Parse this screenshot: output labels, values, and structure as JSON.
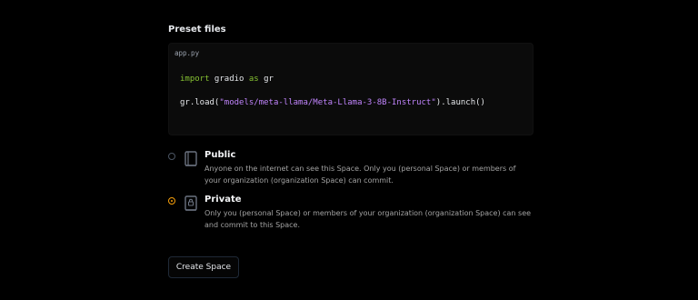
{
  "preset_files": {
    "title": "Preset files",
    "filename": "app.py",
    "code": {
      "line1": {
        "kw1": "import",
        "mod": " gradio ",
        "kw2": "as",
        "alias": " gr"
      },
      "line2": {
        "obj": "gr",
        "call_open": ".load(",
        "string": "\"models/meta-llama/Meta-Llama-3-8B-Instruct\"",
        "call_close": ").launch()"
      }
    }
  },
  "visibility": {
    "options": [
      {
        "title": "Public",
        "description": "Anyone on the internet can see this Space. Only you (personal Space) or members of your organization (organization Space) can commit.",
        "selected": false,
        "icon": "book-icon"
      },
      {
        "title": "Private",
        "description": "Only you (personal Space) or members of your organization (organization Space) can see and commit to this Space.",
        "selected": true,
        "icon": "lock-book-icon"
      }
    ]
  },
  "actions": {
    "create_label": "Create Space"
  },
  "colors": {
    "background": "#000000",
    "accent_selected": "#f59e0b",
    "keyword": "#86c232",
    "string": "#c084fc"
  }
}
